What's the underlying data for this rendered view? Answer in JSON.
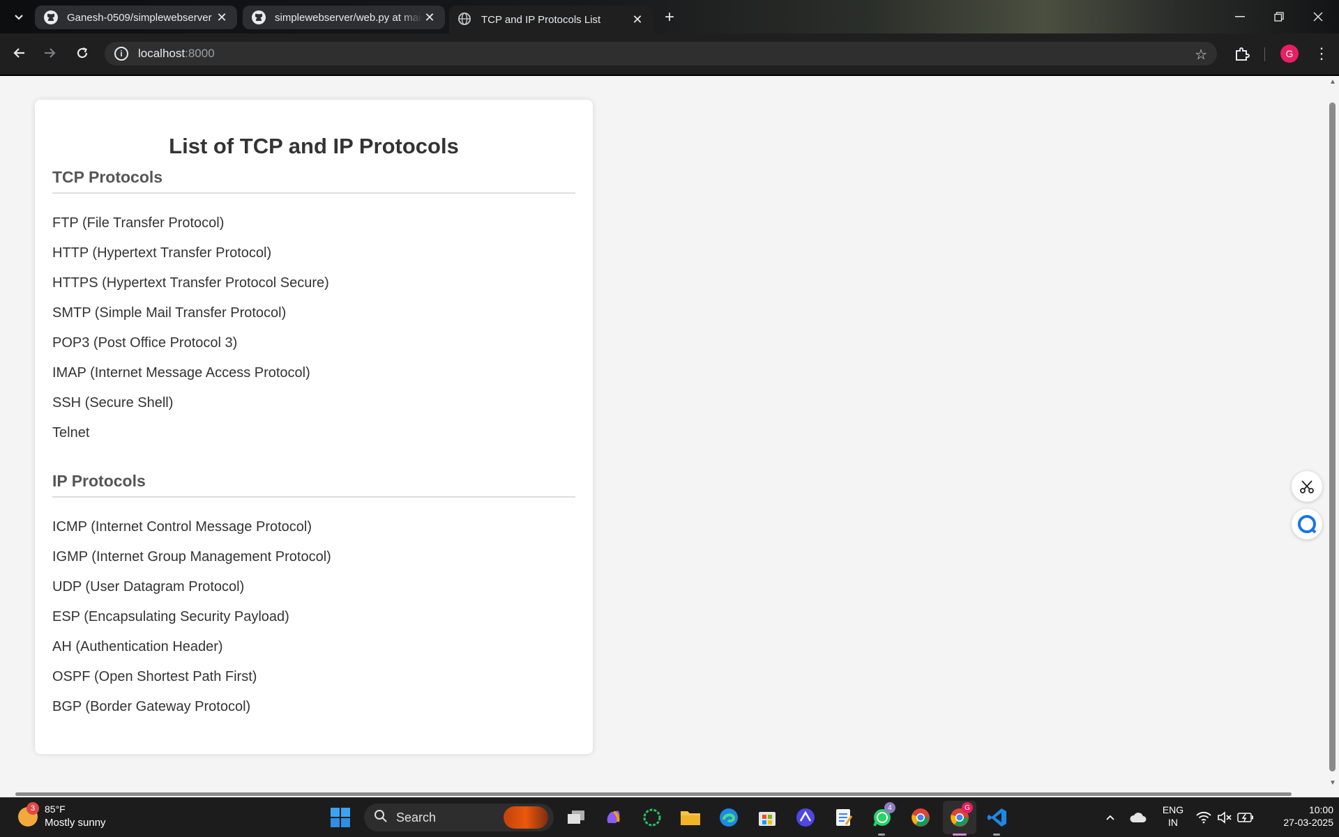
{
  "browser": {
    "tabs": [
      {
        "title": "Ganesh-0509/simplewebserver",
        "active": false
      },
      {
        "title": "simplewebserver/web.py at main",
        "active": false
      },
      {
        "title": "TCP and IP Protocols List",
        "active": true
      }
    ],
    "url_host": "localhost",
    "url_port": ":8000",
    "profile_initial": "G"
  },
  "page": {
    "title": "List of TCP and IP Protocols",
    "tcp_heading": "TCP Protocols",
    "tcp_items": [
      "FTP (File Transfer Protocol)",
      "HTTP (Hypertext Transfer Protocol)",
      "HTTPS (Hypertext Transfer Protocol Secure)",
      "SMTP (Simple Mail Transfer Protocol)",
      "POP3 (Post Office Protocol 3)",
      "IMAP (Internet Message Access Protocol)",
      "SSH (Secure Shell)",
      "Telnet"
    ],
    "ip_heading": "IP Protocols",
    "ip_items": [
      "ICMP (Internet Control Message Protocol)",
      "IGMP (Internet Group Management Protocol)",
      "UDP (User Datagram Protocol)",
      "ESP (Encapsulating Security Payload)",
      "AH (Authentication Header)",
      "OSPF (Open Shortest Path First)",
      "BGP (Border Gateway Protocol)"
    ]
  },
  "taskbar": {
    "weather_badge": "3",
    "weather_temp": "85°F",
    "weather_desc": "Mostly sunny",
    "search_label": "Search",
    "whatsapp_badge": "4",
    "chrome_badge": "G",
    "lang_line1": "ENG",
    "lang_line2": "IN",
    "time": "10:00",
    "date": "27-03-2025"
  },
  "colors": {
    "page_bg": "#f4f4f4",
    "card_bg": "#ffffff",
    "title_text": "#333333",
    "heading_text": "#555555",
    "profile_avatar": "#e91e63"
  }
}
